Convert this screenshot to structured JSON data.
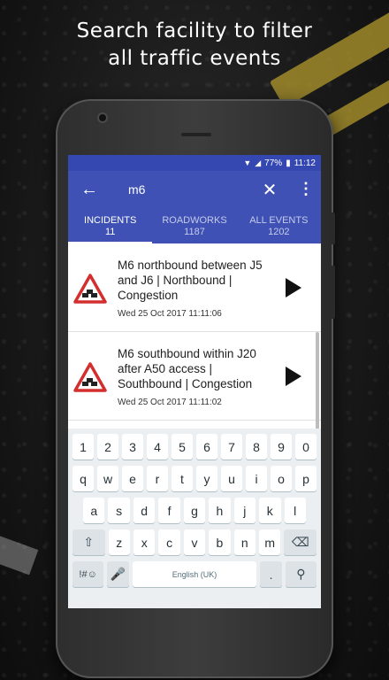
{
  "headline": {
    "line1": "Search facility to filter",
    "line2": "all traffic events"
  },
  "status_bar": {
    "battery": "77%",
    "time": "11:12"
  },
  "toolbar": {
    "search_value": "m6",
    "back_icon": "arrow-left-icon",
    "close_icon": "close-icon",
    "more_icon": "more-vert-icon"
  },
  "tabs": [
    {
      "label": "INCIDENTS",
      "count": "11",
      "active": true
    },
    {
      "label": "ROADWORKS",
      "count": "1187",
      "active": false
    },
    {
      "label": "ALL EVENTS",
      "count": "1202",
      "active": false
    }
  ],
  "events": [
    {
      "title": "M6 northbound between J5 and J6 | Northbound | Congestion",
      "date": "Wed 25 Oct 2017 11:11:06",
      "icon": "traffic-warning-icon"
    },
    {
      "title": "M6 southbound within J20 after A50 access | Southbound | Congestion",
      "date": "Wed 25 Oct 2017 11:11:02",
      "icon": "traffic-warning-icon"
    }
  ],
  "keyboard": {
    "row1": [
      "1",
      "2",
      "3",
      "4",
      "5",
      "6",
      "7",
      "8",
      "9",
      "0"
    ],
    "row2": [
      "q",
      "w",
      "e",
      "r",
      "t",
      "y",
      "u",
      "i",
      "o",
      "p"
    ],
    "row3": [
      "a",
      "s",
      "d",
      "f",
      "g",
      "h",
      "j",
      "k",
      "l"
    ],
    "row4": [
      "z",
      "x",
      "c",
      "v",
      "b",
      "n",
      "m"
    ],
    "symbols": "!#☺",
    "space": "English (UK)",
    "period": "."
  },
  "colors": {
    "primary": "#3f51b5",
    "status": "#3548b2",
    "warning": "#d32f2f"
  }
}
